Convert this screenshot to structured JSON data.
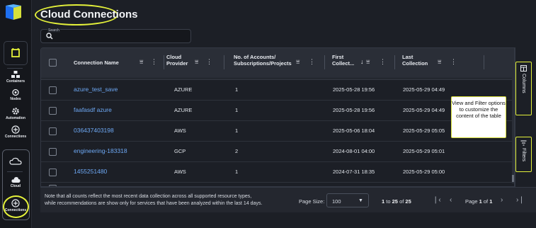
{
  "page": {
    "title": "Cloud Connections"
  },
  "sidebar": {
    "items": [
      {
        "label": "Containers",
        "icon": "containers-icon"
      },
      {
        "label": "Nodes",
        "icon": "nodes-icon"
      },
      {
        "label": "Automation",
        "icon": "automation-icon"
      },
      {
        "label": "Connections",
        "icon": "plus-circle-icon"
      }
    ],
    "cloud_group": [
      {
        "label": "Cloud",
        "icon": "cloud-icon"
      },
      {
        "label": "Connections",
        "icon": "plus-circle-icon"
      }
    ]
  },
  "search": {
    "label": "Search",
    "value": ""
  },
  "table": {
    "columns": [
      {
        "label": "Connection Name"
      },
      {
        "label": "Cloud Provider",
        "line1": "Cloud",
        "line2": "Provider"
      },
      {
        "label": "No. of Accounts/ Subscriptions/Projects",
        "line1": "No. of Accounts/",
        "line2": "Subscriptions/Projects"
      },
      {
        "label": "First Collect...",
        "line1": "First",
        "line2": "Collect..."
      },
      {
        "label": "Last Collection",
        "line1": "Last",
        "line2": "Collection"
      }
    ],
    "rows": [
      {
        "name": "azure_test_save",
        "provider": "AZURE",
        "count": "1",
        "first": "2025-05-28 19:56",
        "last": "2025-05-29 04:49"
      },
      {
        "name": "faafasdf azure",
        "provider": "AZURE",
        "count": "1",
        "first": "2025-05-28 19:56",
        "last": "2025-05-29 04:49"
      },
      {
        "name": "036437403198",
        "provider": "AWS",
        "count": "1",
        "first": "2025-05-06 18:04",
        "last": "2025-05-29 05:05"
      },
      {
        "name": "engineering-183318",
        "provider": "GCP",
        "count": "2",
        "first": "2024-08-01 04:00",
        "last": "2025-05-29 05:01"
      },
      {
        "name": "1455251480",
        "provider": "AWS",
        "count": "1",
        "first": "2024-07-31 18:35",
        "last": "2025-05-29 05:00"
      }
    ]
  },
  "side_panel": {
    "columns_label": "Columns",
    "filters_label": "Filters"
  },
  "tooltip": {
    "text": "View and Filter options to customize the content of the table"
  },
  "footer": {
    "note_line1": "Note that all counts reflect the most recent data collection across all supported resource types,",
    "note_line2": "while recommendations are show only for services that have been analyzed within the last 14 days.",
    "page_size_label": "Page Size:",
    "page_size": "100",
    "range_from": "1",
    "range_to_word": "to",
    "range_to": "25",
    "range_of_word": "of",
    "total": "25",
    "page_word": "Page",
    "page_num": "1",
    "of_word": "of",
    "page_total": "1"
  },
  "colors": {
    "accent": "#e4f13a",
    "link": "#6ea9f5",
    "bg": "#1c1f26"
  }
}
